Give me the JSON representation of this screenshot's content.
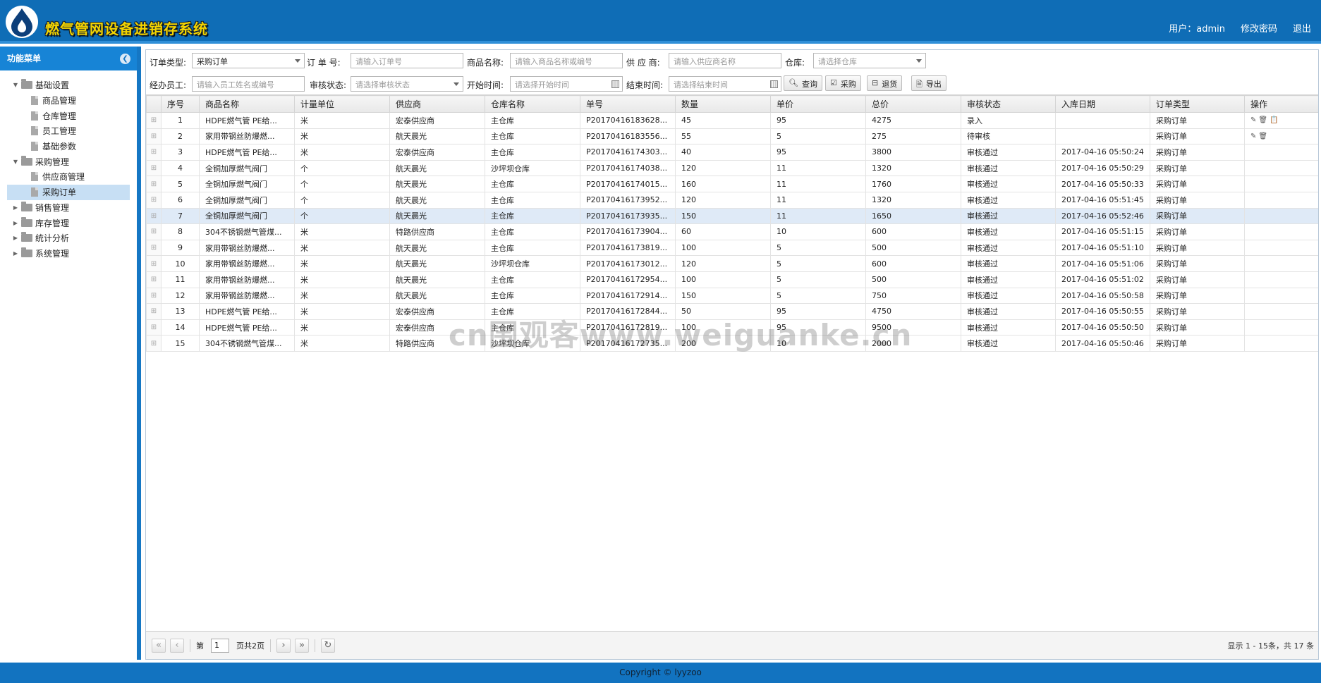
{
  "app": {
    "title": "燃气管网设备进销存系统"
  },
  "header": {
    "user": "用户：admin",
    "change_password": "修改密码",
    "logout": "退出"
  },
  "sidebar": {
    "title": "功能菜单",
    "tree": [
      {
        "label": "基础设置",
        "children": [
          "商品管理",
          "仓库管理",
          "员工管理",
          "基础参数"
        ]
      },
      {
        "label": "采购管理",
        "children": [
          "供应商管理",
          "采购订单"
        ]
      },
      {
        "label": "销售管理"
      },
      {
        "label": "库存管理"
      },
      {
        "label": "统计分析"
      },
      {
        "label": "系统管理"
      }
    ],
    "selected": "采购订单"
  },
  "filters": {
    "order_type_label": "订单类型:",
    "order_type_value": "采购订单",
    "order_no_label": "订 单 号:",
    "order_no_placeholder": "请输入订单号",
    "product_label": "商品名称:",
    "product_placeholder": "请输入商品名称或编号",
    "supplier_label": "供 应 商:",
    "supplier_placeholder": "请输入供应商名称",
    "warehouse_label": "仓库:",
    "warehouse_placeholder": "请选择仓库",
    "employee_label": "经办员工:",
    "employee_placeholder": "请输入员工姓名或编号",
    "audit_label": "审核状态:",
    "audit_placeholder": "请选择审核状态",
    "start_label": "开始时间:",
    "start_placeholder": "请选择开始时间",
    "end_label": "结束时间:",
    "end_placeholder": "请选择结束时间",
    "buttons": {
      "query": "查询",
      "purchase": "采购",
      "return": "退货",
      "export": "导出"
    }
  },
  "grid": {
    "columns": [
      "序号",
      "商品名称",
      "计量单位",
      "供应商",
      "仓库名称",
      "单号",
      "数量",
      "单价",
      "总价",
      "审核状态",
      "入库日期",
      "订单类型",
      "操作"
    ],
    "rows": [
      [
        "1",
        "HDPE燃气管 PE给...",
        "米",
        "宏泰供应商",
        "主仓库",
        "P20170416183628...",
        "45",
        "95",
        "4275",
        "录入",
        "",
        "采购订单",
        "✎🗑📋"
      ],
      [
        "2",
        "家用带钢丝防爆燃...",
        "米",
        "航天晨光",
        "主仓库",
        "P20170416183556...",
        "55",
        "5",
        "275",
        "待审核",
        "",
        "采购订单",
        "✎🗑"
      ],
      [
        "3",
        "HDPE燃气管 PE给...",
        "米",
        "宏泰供应商",
        "主仓库",
        "P20170416174303...",
        "40",
        "95",
        "3800",
        "审核通过",
        "2017-04-16 05:50:24",
        "采购订单",
        ""
      ],
      [
        "4",
        "全铜加厚燃气阀门",
        "个",
        "航天晨光",
        "沙坪坝仓库",
        "P20170416174038...",
        "120",
        "11",
        "1320",
        "审核通过",
        "2017-04-16 05:50:29",
        "采购订单",
        ""
      ],
      [
        "5",
        "全铜加厚燃气阀门",
        "个",
        "航天晨光",
        "主仓库",
        "P20170416174015...",
        "160",
        "11",
        "1760",
        "审核通过",
        "2017-04-16 05:50:33",
        "采购订单",
        ""
      ],
      [
        "6",
        "全铜加厚燃气阀门",
        "个",
        "航天晨光",
        "主仓库",
        "P20170416173952...",
        "120",
        "11",
        "1320",
        "审核通过",
        "2017-04-16 05:51:45",
        "采购订单",
        ""
      ],
      [
        "7",
        "全铜加厚燃气阀门",
        "个",
        "航天晨光",
        "主仓库",
        "P20170416173935...",
        "150",
        "11",
        "1650",
        "审核通过",
        "2017-04-16 05:52:46",
        "采购订单",
        ""
      ],
      [
        "8",
        "304不锈钢燃气管煤...",
        "米",
        "特路供应商",
        "主仓库",
        "P20170416173904...",
        "60",
        "10",
        "600",
        "审核通过",
        "2017-04-16 05:51:15",
        "采购订单",
        ""
      ],
      [
        "9",
        "家用带钢丝防爆燃...",
        "米",
        "航天晨光",
        "主仓库",
        "P20170416173819...",
        "100",
        "5",
        "500",
        "审核通过",
        "2017-04-16 05:51:10",
        "采购订单",
        ""
      ],
      [
        "10",
        "家用带钢丝防爆燃...",
        "米",
        "航天晨光",
        "沙坪坝仓库",
        "P20170416173012...",
        "120",
        "5",
        "600",
        "审核通过",
        "2017-04-16 05:51:06",
        "采购订单",
        ""
      ],
      [
        "11",
        "家用带钢丝防爆燃...",
        "米",
        "航天晨光",
        "主仓库",
        "P20170416172954...",
        "100",
        "5",
        "500",
        "审核通过",
        "2017-04-16 05:51:02",
        "采购订单",
        ""
      ],
      [
        "12",
        "家用带钢丝防爆燃...",
        "米",
        "航天晨光",
        "主仓库",
        "P20170416172914...",
        "150",
        "5",
        "750",
        "审核通过",
        "2017-04-16 05:50:58",
        "采购订单",
        ""
      ],
      [
        "13",
        "HDPE燃气管 PE给...",
        "米",
        "宏泰供应商",
        "主仓库",
        "P20170416172844...",
        "50",
        "95",
        "4750",
        "审核通过",
        "2017-04-16 05:50:55",
        "采购订单",
        ""
      ],
      [
        "14",
        "HDPE燃气管 PE给...",
        "米",
        "宏泰供应商",
        "主仓库",
        "P20170416172819...",
        "100",
        "95",
        "9500",
        "审核通过",
        "2017-04-16 05:50:50",
        "采购订单",
        ""
      ],
      [
        "15",
        "304不锈钢燃气管煤...",
        "米",
        "特路供应商",
        "沙坪坝仓库",
        "P20170416172735...",
        "200",
        "10",
        "2000",
        "审核通过",
        "2017-04-16 05:50:46",
        "采购订单",
        ""
      ]
    ],
    "highlighted_row": 7
  },
  "pager": {
    "page_prefix": "第",
    "page_value": "1",
    "page_suffix": "页共2页",
    "info": "显示 1 - 15条，共 17 条"
  },
  "footer": {
    "copyright": "Copyright © lyyzoo"
  },
  "watermark": "cn围观客www.weiguanke.cn",
  "colors": {
    "header_bg": "#0f6db6",
    "accent": "#1784d6",
    "title_text": "#f4d400"
  }
}
